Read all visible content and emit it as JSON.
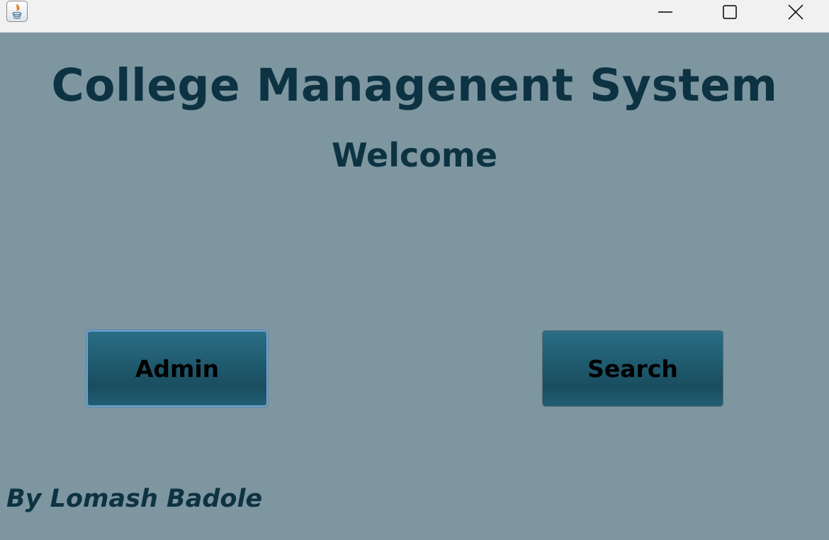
{
  "window": {
    "app_icon": "java-icon",
    "controls": {
      "minimize": "minimize-icon",
      "maximize": "maximize-icon",
      "close": "close-icon"
    }
  },
  "main": {
    "title": "College Managenent System",
    "subtitle": "Welcome",
    "buttons": {
      "admin_label": "Admin",
      "search_label": "Search"
    },
    "footer": "By Lomash Badole"
  },
  "colors": {
    "background": "#7d96a0",
    "text": "#0d3343",
    "button": "#1f5a6e",
    "focus_ring": "#6fa2cf"
  }
}
